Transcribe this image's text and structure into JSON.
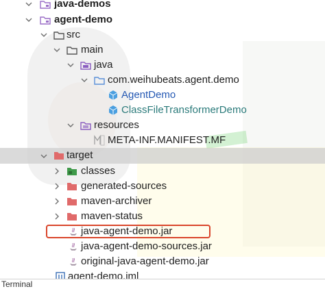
{
  "tree": [
    {
      "label": "java-demos",
      "bold": true,
      "icon": "module-folder-icon",
      "arrow": "down"
    },
    {
      "label": "agent-demo",
      "bold": true,
      "icon": "module-folder-icon",
      "arrow": "down"
    },
    {
      "label": "src",
      "icon": "source-folder-icon",
      "arrow": "down"
    },
    {
      "label": "main",
      "icon": "folder-icon",
      "arrow": "down"
    },
    {
      "label": "java",
      "icon": "source-root-icon",
      "arrow": "down"
    },
    {
      "label": "com.weihubeats.agent.demo",
      "icon": "package-icon",
      "arrow": "down"
    },
    {
      "label": "AgentDemo",
      "icon": "java-class-icon",
      "arrow": "none"
    },
    {
      "label": "ClassFileTransformerDemo",
      "icon": "java-class-icon",
      "arrow": "none"
    },
    {
      "label": "resources",
      "icon": "resources-folder-icon",
      "arrow": "down"
    },
    {
      "label": "META-INF.MANIFEST.MF",
      "icon": "manifest-file-icon",
      "arrow": "none"
    },
    {
      "label": "target",
      "icon": "excluded-folder-icon",
      "arrow": "down"
    },
    {
      "label": "classes",
      "icon": "classes-folder-icon",
      "arrow": "right"
    },
    {
      "label": "generated-sources",
      "icon": "excluded-folder-icon",
      "arrow": "right"
    },
    {
      "label": "maven-archiver",
      "icon": "excluded-folder-icon",
      "arrow": "right"
    },
    {
      "label": "maven-status",
      "icon": "excluded-folder-icon",
      "arrow": "right"
    },
    {
      "label": "java-agent-demo.jar",
      "icon": "jar-file-icon",
      "arrow": "none",
      "highlighted": true
    },
    {
      "label": "java-agent-demo-sources.jar",
      "icon": "jar-file-icon",
      "arrow": "none"
    },
    {
      "label": "original-java-agent-demo.jar",
      "icon": "jar-file-icon",
      "arrow": "none"
    },
    {
      "label": "agent-demo.iml",
      "icon": "iml-file-icon",
      "arrow": "none"
    }
  ],
  "bottom_tab": {
    "label": "Terminal"
  },
  "colors": {
    "highlight_border": "#d9442a",
    "class_blue": "#2458b3",
    "excluded_folder": "#e06a6a",
    "module_folder": "#9b6fc7"
  }
}
